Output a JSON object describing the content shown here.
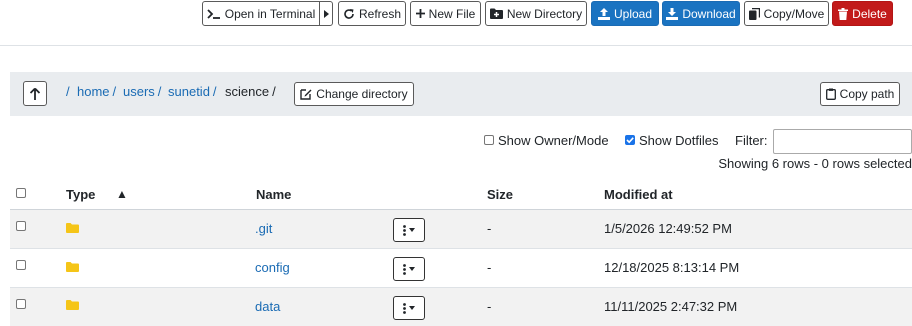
{
  "toolbar": {
    "open_terminal": "Open in Terminal",
    "refresh": "Refresh",
    "new_file": "New File",
    "new_directory": "New Directory",
    "upload": "Upload",
    "download": "Download",
    "copy_move": "Copy/Move",
    "delete": "Delete"
  },
  "breadcrumb": {
    "root": "/",
    "items": [
      "home",
      "users",
      "sunetid"
    ],
    "current": "science",
    "separator": "/"
  },
  "change_directory": "Change directory",
  "copy_path": "Copy path",
  "options": {
    "show_owner_mode": {
      "label": "Show Owner/Mode",
      "checked": false
    },
    "show_dotfiles": {
      "label": "Show Dotfiles",
      "checked": true
    },
    "filter_label": "Filter:",
    "filter_value": ""
  },
  "status": "Showing 6 rows - 0 rows selected",
  "table": {
    "columns": {
      "type": "Type",
      "name": "Name",
      "size": "Size",
      "modified": "Modified at"
    },
    "sort_indicator": "▲",
    "rows": [
      {
        "type": "folder",
        "name": ".git",
        "size": "-",
        "modified": "1/5/2026 12:49:52 PM"
      },
      {
        "type": "folder",
        "name": "config",
        "size": "-",
        "modified": "12/18/2025 8:13:14 PM"
      },
      {
        "type": "folder",
        "name": "data",
        "size": "-",
        "modified": "11/11/2025 2:47:32 PM"
      }
    ]
  },
  "colors": {
    "primary": "#1a73c1",
    "danger": "#c21a1a",
    "link": "#1a6bb4",
    "folder": "#f5c518"
  }
}
